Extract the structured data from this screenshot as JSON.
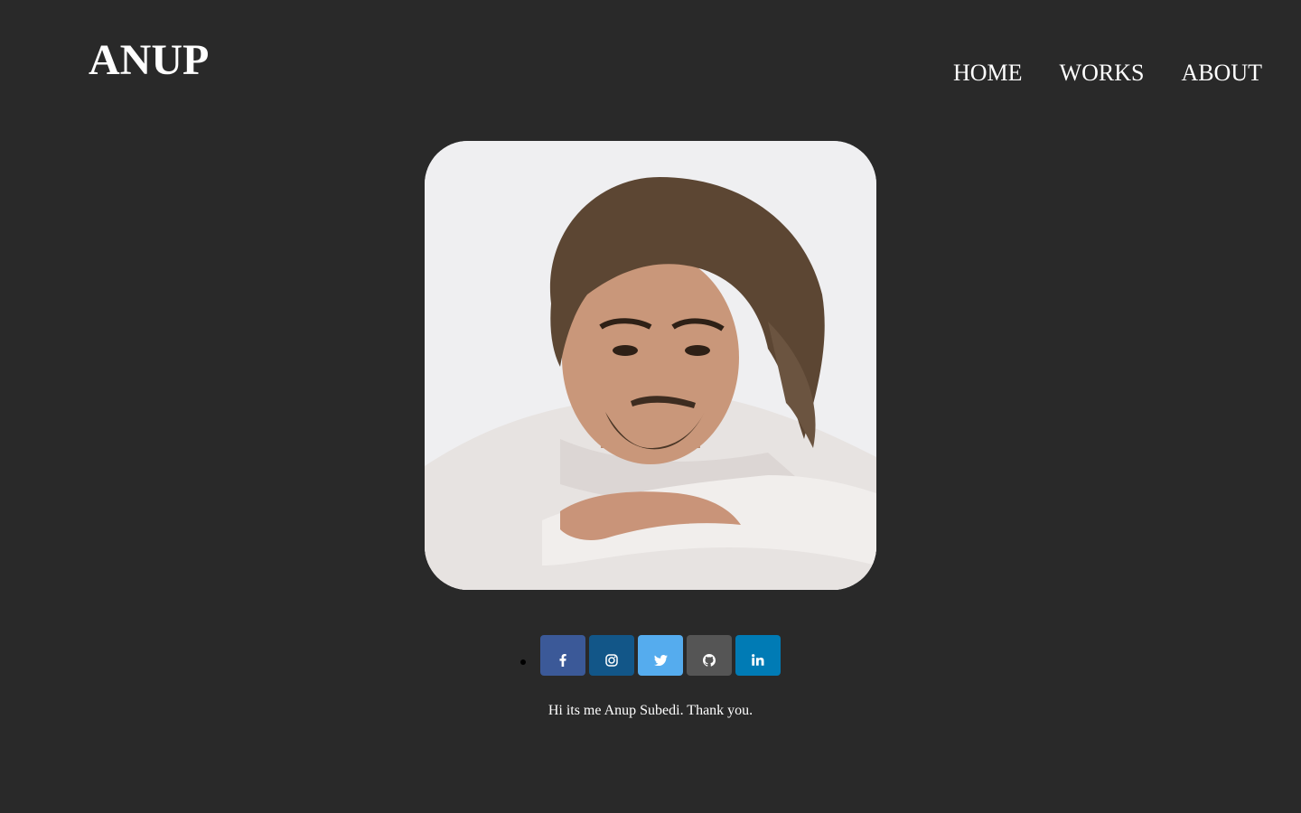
{
  "header": {
    "brand": "ANUP",
    "nav": [
      {
        "label": "HOME"
      },
      {
        "label": "WORKS"
      },
      {
        "label": "ABOUT"
      }
    ]
  },
  "hero": {
    "image_alt": "portrait-photo"
  },
  "social": [
    {
      "name": "facebook-icon",
      "color": "#3b5998"
    },
    {
      "name": "instagram-icon",
      "color": "#125688"
    },
    {
      "name": "twitter-icon",
      "color": "#55acee"
    },
    {
      "name": "github-icon",
      "color": "#555555"
    },
    {
      "name": "linkedin-icon",
      "color": "#007bb5"
    }
  ],
  "caption": "Hi its me Anup Subedi. Thank you."
}
